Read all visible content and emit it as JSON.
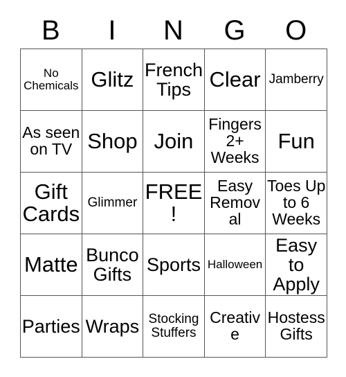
{
  "card": {
    "headers": [
      "B",
      "I",
      "N",
      "G",
      "O"
    ],
    "rows": [
      [
        {
          "text": "No Chemicals",
          "size": "size-xs"
        },
        {
          "text": "Glitz",
          "size": "size-xl"
        },
        {
          "text": "French Tips",
          "size": "size-lg"
        },
        {
          "text": "Clear",
          "size": "size-xl"
        },
        {
          "text": "Jamberry",
          "size": "size-sm"
        }
      ],
      [
        {
          "text": "As seen on TV",
          "size": "size-md"
        },
        {
          "text": "Shop",
          "size": "size-xl"
        },
        {
          "text": "Join",
          "size": "size-xl"
        },
        {
          "text": "Fingers 2+ Weeks",
          "size": "size-md"
        },
        {
          "text": "Fun",
          "size": "size-xl"
        }
      ],
      [
        {
          "text": "Gift Cards",
          "size": "size-xl"
        },
        {
          "text": "Glimmer",
          "size": "size-sm"
        },
        {
          "text": "FREE!",
          "size": "size-xl"
        },
        {
          "text": "Easy Removal",
          "size": "size-md"
        },
        {
          "text": "Toes Up to 6 Weeks",
          "size": "size-md"
        }
      ],
      [
        {
          "text": "Matte",
          "size": "size-xl"
        },
        {
          "text": "Bunco Gifts",
          "size": "size-lg"
        },
        {
          "text": "Sports",
          "size": "size-lg"
        },
        {
          "text": "Halloween",
          "size": "size-xs"
        },
        {
          "text": "Easy to Apply",
          "size": "size-lg"
        }
      ],
      [
        {
          "text": "Parties",
          "size": "size-lg"
        },
        {
          "text": "Wraps",
          "size": "size-lg"
        },
        {
          "text": "Stocking Stuffers",
          "size": "size-sm"
        },
        {
          "text": "Creative",
          "size": "size-md"
        },
        {
          "text": "Hostess Gifts",
          "size": "size-md"
        }
      ]
    ]
  }
}
